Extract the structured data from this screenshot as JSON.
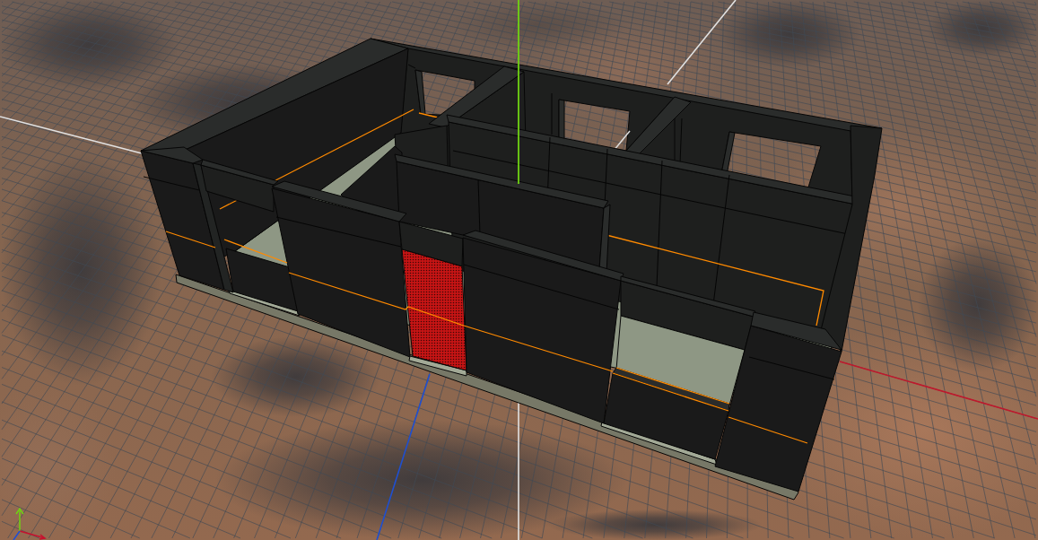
{
  "viewport": {
    "objects": [
      {
        "kind": "walls",
        "selected": false
      },
      {
        "kind": "door",
        "selected": true
      }
    ]
  }
}
